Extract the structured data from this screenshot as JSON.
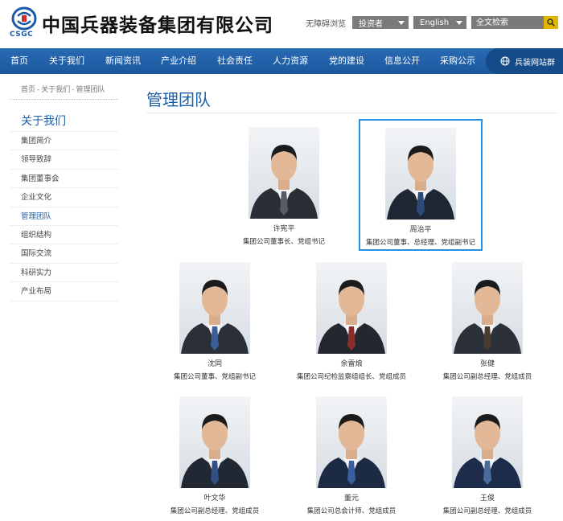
{
  "header": {
    "logo_text": "CSGC",
    "site_title": "中国兵器装备集团有限公司",
    "accessibility_link": "无障碍浏览",
    "investor_select": "投资者",
    "language_select": "English",
    "search_placeholder": "全文检索"
  },
  "nav": {
    "items": [
      "首页",
      "关于我们",
      "新闻资讯",
      "产业介绍",
      "社会责任",
      "人力资源",
      "党的建设",
      "信息公开",
      "采购公示"
    ],
    "site_group": "兵装网站群"
  },
  "breadcrumb": [
    "首页",
    "关于我们",
    "管理团队"
  ],
  "breadcrumb_sep": "-",
  "sidebar": {
    "title": "关于我们",
    "items": [
      "集团简介",
      "领导致辞",
      "集团董事会",
      "企业文化",
      "管理团队",
      "组织结构",
      "国际交流",
      "科研实力",
      "产业布局"
    ],
    "active_index": 4
  },
  "main": {
    "title": "管理团队",
    "members": [
      {
        "name": "许宪平",
        "role": "集团公司董事长、党组书记"
      },
      {
        "name": "周治平",
        "role": "集团公司董事、总经理、党组副书记"
      },
      {
        "name": "沈同",
        "role": "集团公司董事、党组副书记"
      },
      {
        "name": "余雷烺",
        "role": "集团公司纪检监察组组长、党组成员"
      },
      {
        "name": "张健",
        "role": "集团公司副总经理、党组成员"
      },
      {
        "name": "叶文华",
        "role": "集团公司副总经理、党组成员"
      },
      {
        "name": "董元",
        "role": "集团公司总会计师、党组成员"
      },
      {
        "name": "王俊",
        "role": "集团公司副总经理、党组成员"
      }
    ]
  },
  "colors": {
    "brand_blue": "#1f5fa8",
    "nav_dark": "#164b89",
    "selection_border": "#2b8fe0",
    "search_button": "#e2b500"
  },
  "icons": {
    "logo": "csgc-logo-icon",
    "search": "search-icon",
    "globe": "globe-icon",
    "dropdown": "chevron-down-icon"
  }
}
